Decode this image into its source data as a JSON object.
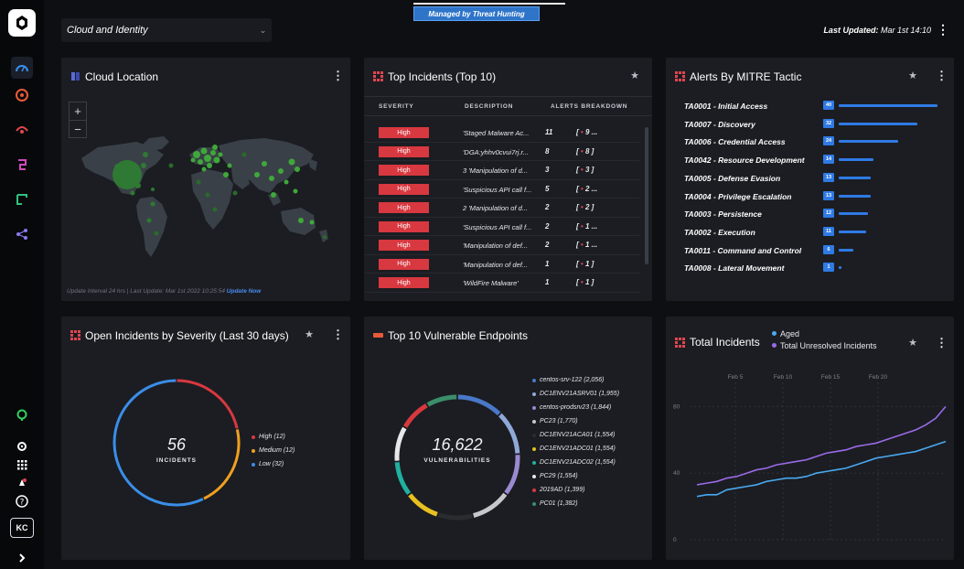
{
  "header": {
    "managed_badge": "Managed by Threat Hunting",
    "dashboard_select": "Cloud and Identity",
    "last_updated_label": "Last Updated:",
    "last_updated_value": "Mar 1st 14:10"
  },
  "nav": {
    "user_initials": "KC"
  },
  "cloud_location": {
    "title": "Cloud Location",
    "zoom_in": "+",
    "zoom_out": "−",
    "footer": "Update Interval 24 hrs | Last Update: Mar 1st 2022 10:25:54",
    "update_now": "Update Now"
  },
  "top_incidents": {
    "title": "Top Incidents (Top 10)",
    "columns": [
      "SEVERITY",
      "DESCRIPTION",
      "ALERTS BREAKDOWN"
    ],
    "rows": [
      {
        "severity": "High",
        "description": "'Staged Malware Ac...",
        "count": "11",
        "breakdown": "9 ..."
      },
      {
        "severity": "High",
        "description": "'DGA:yhhv0cvui7rj.r...",
        "count": "8",
        "breakdown": "8 ]"
      },
      {
        "severity": "High",
        "description": "3 'Manipulation of d...",
        "count": "3",
        "breakdown": "3 ]"
      },
      {
        "severity": "High",
        "description": "'Suspicious API call f...",
        "count": "5",
        "breakdown": "2 ..."
      },
      {
        "severity": "High",
        "description": "2 'Manipulation of d...",
        "count": "2",
        "breakdown": "2 ]"
      },
      {
        "severity": "High",
        "description": "'Suspicious API call f...",
        "count": "2",
        "breakdown": "1 ..."
      },
      {
        "severity": "High",
        "description": "'Manipulation of def...",
        "count": "2",
        "breakdown": "1 ..."
      },
      {
        "severity": "High",
        "description": "'Manipulation of def...",
        "count": "1",
        "breakdown": "1 ]"
      },
      {
        "severity": "High",
        "description": "'WildFire Malware'",
        "count": "1",
        "breakdown": "1 ]"
      }
    ]
  },
  "mitre": {
    "title": "Alerts By MITRE Tactic",
    "colors": {
      "bar": "#2f7ae5"
    },
    "rows": [
      {
        "label": "TA0001 - Initial Access",
        "count": "40",
        "value": 40
      },
      {
        "label": "TA0007 - Discovery",
        "count": "32",
        "value": 32
      },
      {
        "label": "TA0006 - Credential Access",
        "count": "24",
        "value": 24
      },
      {
        "label": "TA0042 - Resource Development",
        "count": "14",
        "value": 14
      },
      {
        "label": "TA0005 - Defense Evasion",
        "count": "13",
        "value": 13
      },
      {
        "label": "TA0004 - Privilege Escalation",
        "count": "13",
        "value": 13
      },
      {
        "label": "TA0003 - Persistence",
        "count": "12",
        "value": 12
      },
      {
        "label": "TA0002 - Execution",
        "count": "11",
        "value": 11
      },
      {
        "label": "TA0011 - Command and Control",
        "count": "6",
        "value": 6
      },
      {
        "label": "TA0008 - Lateral Movement",
        "count": "1",
        "value": 1
      }
    ]
  },
  "open_incidents": {
    "title": "Open Incidents by Severity (Last 30 days)",
    "total": "56",
    "total_label": "INCIDENTS",
    "legend": [
      {
        "label": "High (12)",
        "value": 12,
        "color": "#d8383f"
      },
      {
        "label": "Medium (12)",
        "value": 12,
        "color": "#f0a020"
      },
      {
        "label": "Low (32)",
        "value": 32,
        "color": "#3a8ee8"
      }
    ]
  },
  "vulnerable_endpoints": {
    "title": "Top 10 Vulnerable Endpoints",
    "total": "16,622",
    "total_label": "VULNERABILITIES",
    "legend": [
      {
        "label": "centos-srv-122 (2,056)",
        "value": 2056,
        "color": "#4a78c8"
      },
      {
        "label": "DC1ENV21ASRV01 (1,955)",
        "value": 1955,
        "color": "#8fa8d8"
      },
      {
        "label": "centos-prodsrv23 (1,844)",
        "value": 1844,
        "color": "#9a8ad0"
      },
      {
        "label": "PC23 (1,770)",
        "value": 1770,
        "color": "#c8c8cc"
      },
      {
        "label": "DC1ENV21ACA01 (1,554)",
        "value": 1554,
        "color": "#2a2c30"
      },
      {
        "label": "DC1ENV21ADC01 (1,554)",
        "value": 1554,
        "color": "#e8c020"
      },
      {
        "label": "DC1ENV21ADC02 (1,554)",
        "value": 1554,
        "color": "#20b0a0"
      },
      {
        "label": "PC29 (1,554)",
        "value": 1554,
        "color": "#e8e8ea"
      },
      {
        "label": "2019AD (1,399)",
        "value": 1399,
        "color": "#d8383f"
      },
      {
        "label": "PC01 (1,382)",
        "value": 1382,
        "color": "#3a8e6a"
      }
    ]
  },
  "total_incidents": {
    "title": "Total Incidents",
    "legend": [
      {
        "label": "Aged",
        "color": "#4aa8f0"
      },
      {
        "label": "Total Unresolved Incidents",
        "color": "#9a6ae8"
      }
    ],
    "chart_data": {
      "type": "line",
      "x_ticks": [
        "Feb 5",
        "Feb 10",
        "Feb 15",
        "Feb 20"
      ],
      "y_ticks": [
        "0",
        "40",
        "80"
      ],
      "ylim": [
        0,
        100
      ],
      "series": [
        {
          "name": "Aged",
          "color": "#4aa8f0",
          "values": [
            26,
            27,
            27,
            30,
            31,
            32,
            33,
            35,
            36,
            37,
            37,
            38,
            40,
            41,
            42,
            43,
            45,
            47,
            49,
            50,
            51,
            52,
            53,
            55,
            57,
            59
          ]
        },
        {
          "name": "Total Unresolved Incidents",
          "color": "#9a6ae8",
          "values": [
            33,
            34,
            35,
            37,
            38,
            40,
            42,
            43,
            45,
            46,
            47,
            48,
            50,
            52,
            53,
            54,
            56,
            57,
            58,
            60,
            62,
            64,
            66,
            69,
            73,
            80
          ]
        }
      ]
    }
  }
}
